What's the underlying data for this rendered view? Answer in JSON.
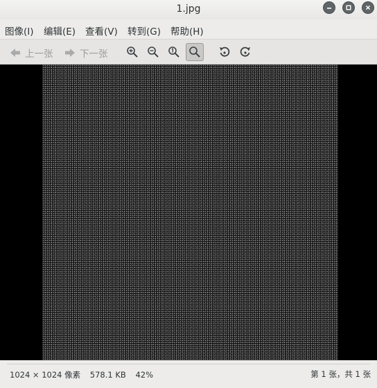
{
  "window": {
    "title": "1.jpg",
    "buttons": [
      {
        "name": "minimize",
        "icon": "minimize-icon"
      },
      {
        "name": "maximize",
        "icon": "maximize-icon"
      },
      {
        "name": "close",
        "icon": "close-icon"
      }
    ]
  },
  "menu": {
    "image": "图像(I)",
    "edit": "编辑(E)",
    "view": "查看(V)",
    "go": "转到(G)",
    "help": "帮助(H)"
  },
  "toolbar": {
    "prev_label": "上一张",
    "next_label": "下一张",
    "icons": [
      "arrow-left-icon",
      "arrow-right-icon",
      "zoom-in-icon",
      "zoom-out-icon",
      "zoom-normal-icon",
      "zoom-fit-icon",
      "rotate-left-icon",
      "rotate-right-icon"
    ],
    "active": "zoom-fit-icon"
  },
  "status": {
    "dimensions": "1024 × 1024 像素",
    "file_size": "578.1 KB",
    "zoom": "42%",
    "position": "第 1 张，共 1 张"
  },
  "colors": {
    "window_bg": "#edeceb",
    "viewer_bg": "#000000",
    "disabled_text": "#9a9c9d"
  }
}
